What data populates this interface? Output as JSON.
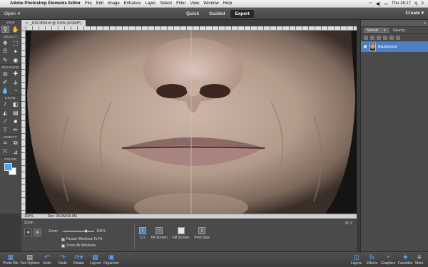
{
  "menubar": {
    "app_name": "Adobe Photoshop Elements Editor",
    "items": [
      "File",
      "Edit",
      "Image",
      "Enhance",
      "Layer",
      "Select",
      "Filter",
      "View",
      "Window",
      "Help"
    ],
    "clock": "Thu 16:17"
  },
  "appbar": {
    "open_label": "Open",
    "modes": [
      "Quick",
      "Guided",
      "Expert"
    ],
    "active_mode": "Expert",
    "create_label": "Create"
  },
  "toolbox": {
    "sections": {
      "view": "VIEW",
      "select": "SELECT",
      "enhance": "ENHANCE",
      "draw": "DRAW",
      "modify": "MODIFY",
      "color": "COLOR"
    },
    "fg_color": "#3fa9f5",
    "bg_color": "#ffffff"
  },
  "document": {
    "tab_title": "_DSC3658.tif @ 100% (RGB/8*)",
    "zoom": "100%",
    "doc_size": "Doc: 39.9M/39.9M"
  },
  "layers": {
    "blend_mode": "Normal",
    "opacity_label": "Opacity:",
    "layer_name": "Background"
  },
  "tool_options": {
    "title": "Zoom",
    "zoom_label": "Zoom",
    "zoom_value": "100%",
    "resize_windows": "Resize Windows To Fit",
    "zoom_all": "Zoom All Windows",
    "btn_1to1": "1:1",
    "btn_fit": "Fit Screen",
    "btn_fill": "Fill Screen",
    "btn_print": "Print Size"
  },
  "bottom_bar": {
    "left": [
      "Photo Bin",
      "Tool Options",
      "Undo",
      "Redo",
      "Rotate",
      "Layout",
      "Organizer"
    ],
    "right": [
      "Layers",
      "Effects",
      "Graphics",
      "Favorites",
      "More"
    ]
  }
}
